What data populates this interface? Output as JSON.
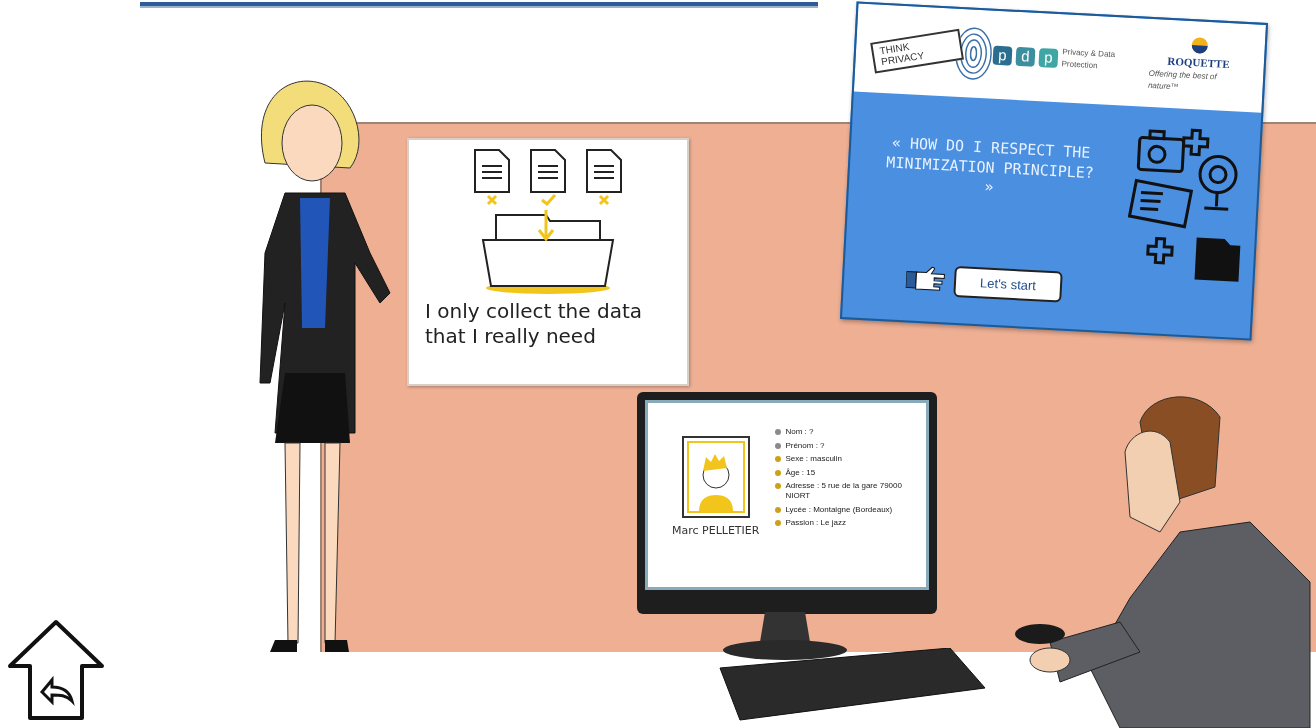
{
  "poster": {
    "documents": [
      {
        "accepted": false
      },
      {
        "accepted": true
      },
      {
        "accepted": false
      }
    ],
    "caption": "I only collect the data that I really need"
  },
  "module_card": {
    "badge": "THINK PRIVACY",
    "pdp_letters": [
      "p",
      "d",
      "p"
    ],
    "pdp_label": "Privacy & Data Protection",
    "company": "ROQUETTE",
    "tagline": "Offering the best of nature™",
    "question": "« HOW DO I RESPECT THE MINIMIZATION PRINCIPLE? »",
    "start_button": "Let's start"
  },
  "monitor": {
    "profile_name": "Marc PELLETIER",
    "fields": [
      {
        "text": "Nom : ?",
        "color": "#8a8a8a"
      },
      {
        "text": "Prénom : ?",
        "color": "#8a8a8a"
      },
      {
        "text": "Sexe : masculin",
        "color": "#c9a21a"
      },
      {
        "text": "Âge : 15",
        "color": "#c9a21a"
      },
      {
        "text": "Adresse : 5 rue de la gare 79000 NIORT",
        "color": "#c9a21a"
      },
      {
        "text": "Lycée : Montaigne (Bordeaux)",
        "color": "#c9a21a"
      },
      {
        "text": "Passion : Le jazz",
        "color": "#c9a21a"
      }
    ]
  }
}
